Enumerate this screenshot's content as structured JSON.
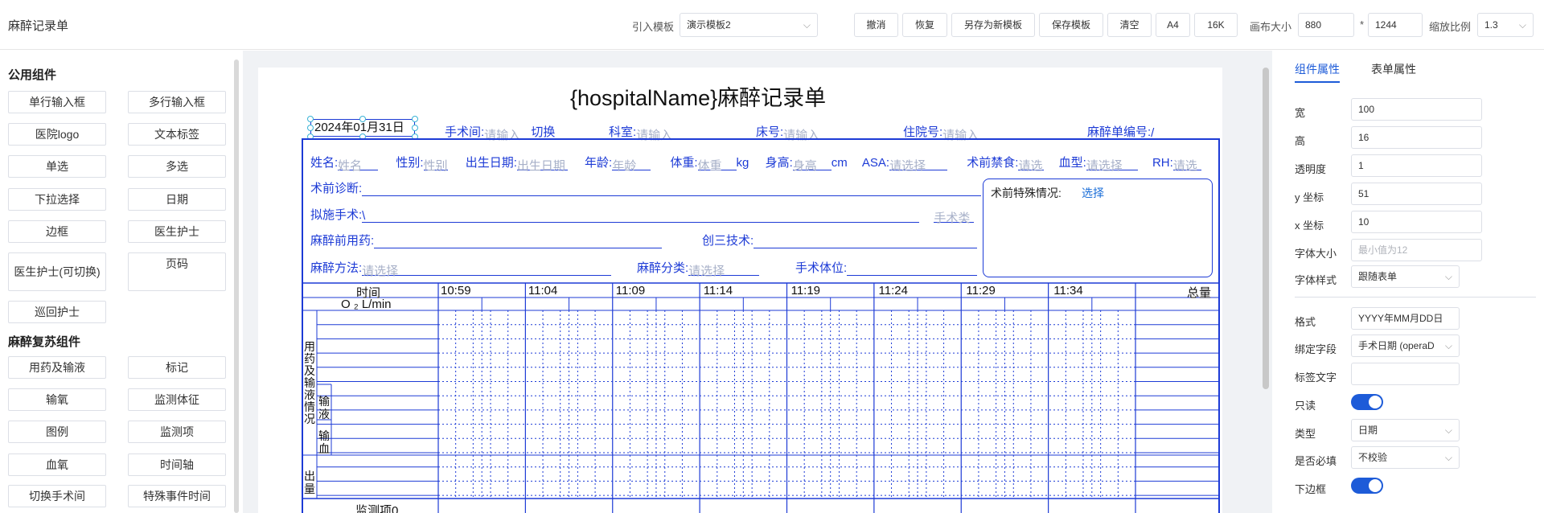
{
  "app": {
    "title": "麻醉记录单"
  },
  "toolbar": {
    "import_label": "引入模板",
    "template_value": "演示模板2",
    "buttons": [
      "撤消",
      "恢复",
      "另存为新模板",
      "保存模板",
      "清空",
      "A4",
      "16K"
    ],
    "canvas_size_label": "画布大小",
    "width_value": "880",
    "times_sign": "*",
    "height_value": "1244",
    "zoom_label": "缩放比例",
    "zoom_value": "1.3"
  },
  "left_panel": {
    "section1": "公用组件",
    "common": [
      "单行输入框",
      "多行输入框",
      "医院logo",
      "文本标签",
      "单选",
      "多选",
      "下拉选择",
      "日期",
      "边框",
      "医生护士",
      "医生护士(可切换)",
      "页码",
      "巡回护士"
    ],
    "section2": "麻醉复苏组件",
    "anesthesia": [
      "用药及输液",
      "标记",
      "输氧",
      "监测体征",
      "图例",
      "监测项",
      "血氧",
      "时间轴",
      "切换手术间",
      "特殊事件时间"
    ]
  },
  "form": {
    "title": "{hospitalName}麻醉记录单",
    "date_value": "2024年01月31日",
    "row1": {
      "room_label": "手术间:",
      "room_ph": "请输入",
      "switch_link": "切换",
      "dept_label": "科室:",
      "dept_ph": "请输入",
      "bed_label": "床号:",
      "bed_ph": "请输入",
      "admission_label": "住院号:",
      "admission_ph": "请输入",
      "record_label": "麻醉单编号:",
      "record_value": "/"
    },
    "row2": {
      "name_label": "姓名:",
      "name_ph": "姓名",
      "sex_label": "性别:",
      "sex_ph": "性别",
      "birth_label": "出生日期:",
      "birth_ph": "出生日期",
      "age_label": "年龄:",
      "age_ph": "年龄",
      "weight_label": "体重:",
      "weight_ph": "体重",
      "weight_unit": "kg",
      "height_label": "身高:",
      "height_ph": "身高",
      "height_unit": "cm",
      "asa_label": "ASA:",
      "asa_ph": "请选择",
      "fasting_label": "术前禁食:",
      "fasting_ph": "请选",
      "blood_label": "血型:",
      "blood_ph": "请选择",
      "rh_label": "RH:",
      "rh_ph": "请选"
    },
    "preop_diag_label": "术前诊断:",
    "planned_op_label": "拟施手术:",
    "planned_op_value": "\\",
    "surgery_type_ph": "手术类",
    "premed_label": "麻醉前用药:",
    "invasive_label": "创三技术:",
    "method_label": "麻醉方法:",
    "method_ph": "请选择",
    "category_label": "麻醉分类:",
    "category_ph": "请选择",
    "position_label": "手术体位:",
    "special_label": "术前特殊情况:",
    "special_link": "选择",
    "grid": {
      "time_label": "时间",
      "times": [
        "10:59",
        "11:04",
        "11:09",
        "11:14",
        "11:19",
        "11:24",
        "11:29",
        "11:34"
      ],
      "total_label": "总量",
      "o2_label": "O ₂ L/min",
      "meds_label": "用药及输液情况",
      "infusion_label": "输液",
      "blood_label": "输血",
      "output_label": "出量",
      "monitor_label": "监测项0"
    }
  },
  "right_panel": {
    "tabs": [
      "组件属性",
      "表单属性"
    ],
    "fields": [
      {
        "label": "宽",
        "value": "100"
      },
      {
        "label": "高",
        "value": "16"
      },
      {
        "label": "透明度",
        "value": "1"
      },
      {
        "label": "y 坐标",
        "value": "51"
      },
      {
        "label": "x 坐标",
        "value": "10"
      },
      {
        "label": "字体大小",
        "placeholder": "最小值为12"
      },
      {
        "label": "字体样式",
        "select": "跟随表单"
      },
      {
        "label": "格式",
        "value": "YYYY年MM月DD日"
      },
      {
        "label": "绑定字段",
        "select": "手术日期 (operaD"
      },
      {
        "label": "标签文字",
        "value": ""
      },
      {
        "label": "只读",
        "toggle": true
      },
      {
        "label": "类型",
        "select": "日期"
      },
      {
        "label": "是否必填",
        "select": "不校验"
      },
      {
        "label": "下边框",
        "toggle": true
      }
    ]
  },
  "colors": {
    "accent": "#1d5bd8",
    "form_blue": "#1d3bd6",
    "placeholder": "#a7b0c8"
  }
}
